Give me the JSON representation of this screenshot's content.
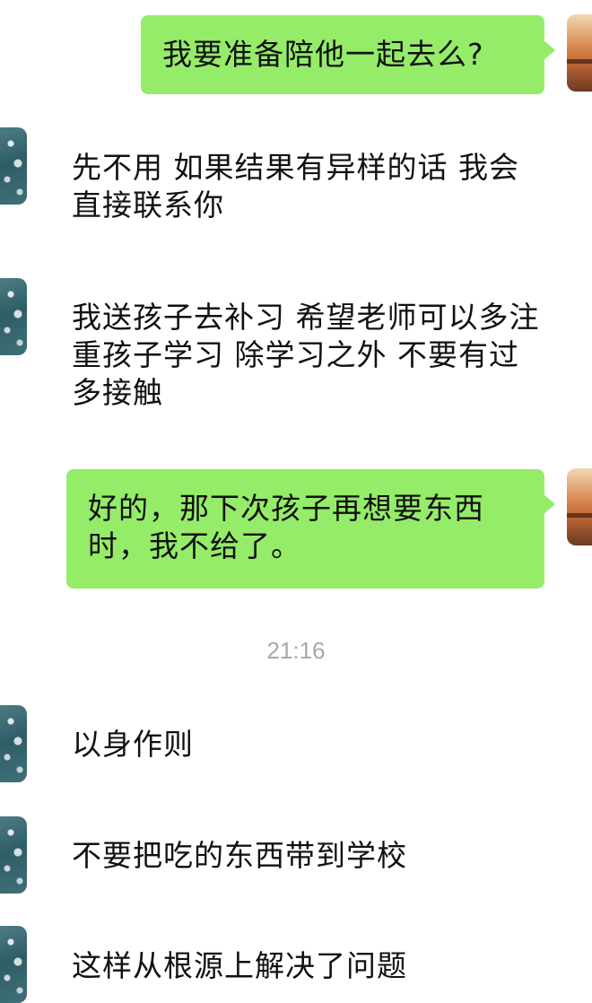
{
  "messages": [
    {
      "side": "me",
      "text": "我要准备陪他一起去么?"
    },
    {
      "side": "them",
      "text": "先不用 如果结果有异样的话 我会直接联系你"
    },
    {
      "side": "them",
      "text": "我送孩子去补习 希望老师可以多注重孩子学习 除学习之外 不要有过多接触"
    },
    {
      "side": "me",
      "text": "好的，那下次孩子再想要东西时，我不给了。"
    },
    {
      "side": "them",
      "text": "以身作则"
    },
    {
      "side": "them",
      "text": "不要把吃的东西带到学校"
    },
    {
      "side": "them",
      "text": "这样从根源上解决了问题"
    }
  ],
  "timestamp": "21:16",
  "colors": {
    "my_bubble": "#95ec69",
    "their_bubble": "#ffffff",
    "timestamp_text": "#a8a8a8"
  },
  "icons": {
    "my_avatar": "sunset-avatar",
    "their_avatar": "water-drops-avatar"
  }
}
